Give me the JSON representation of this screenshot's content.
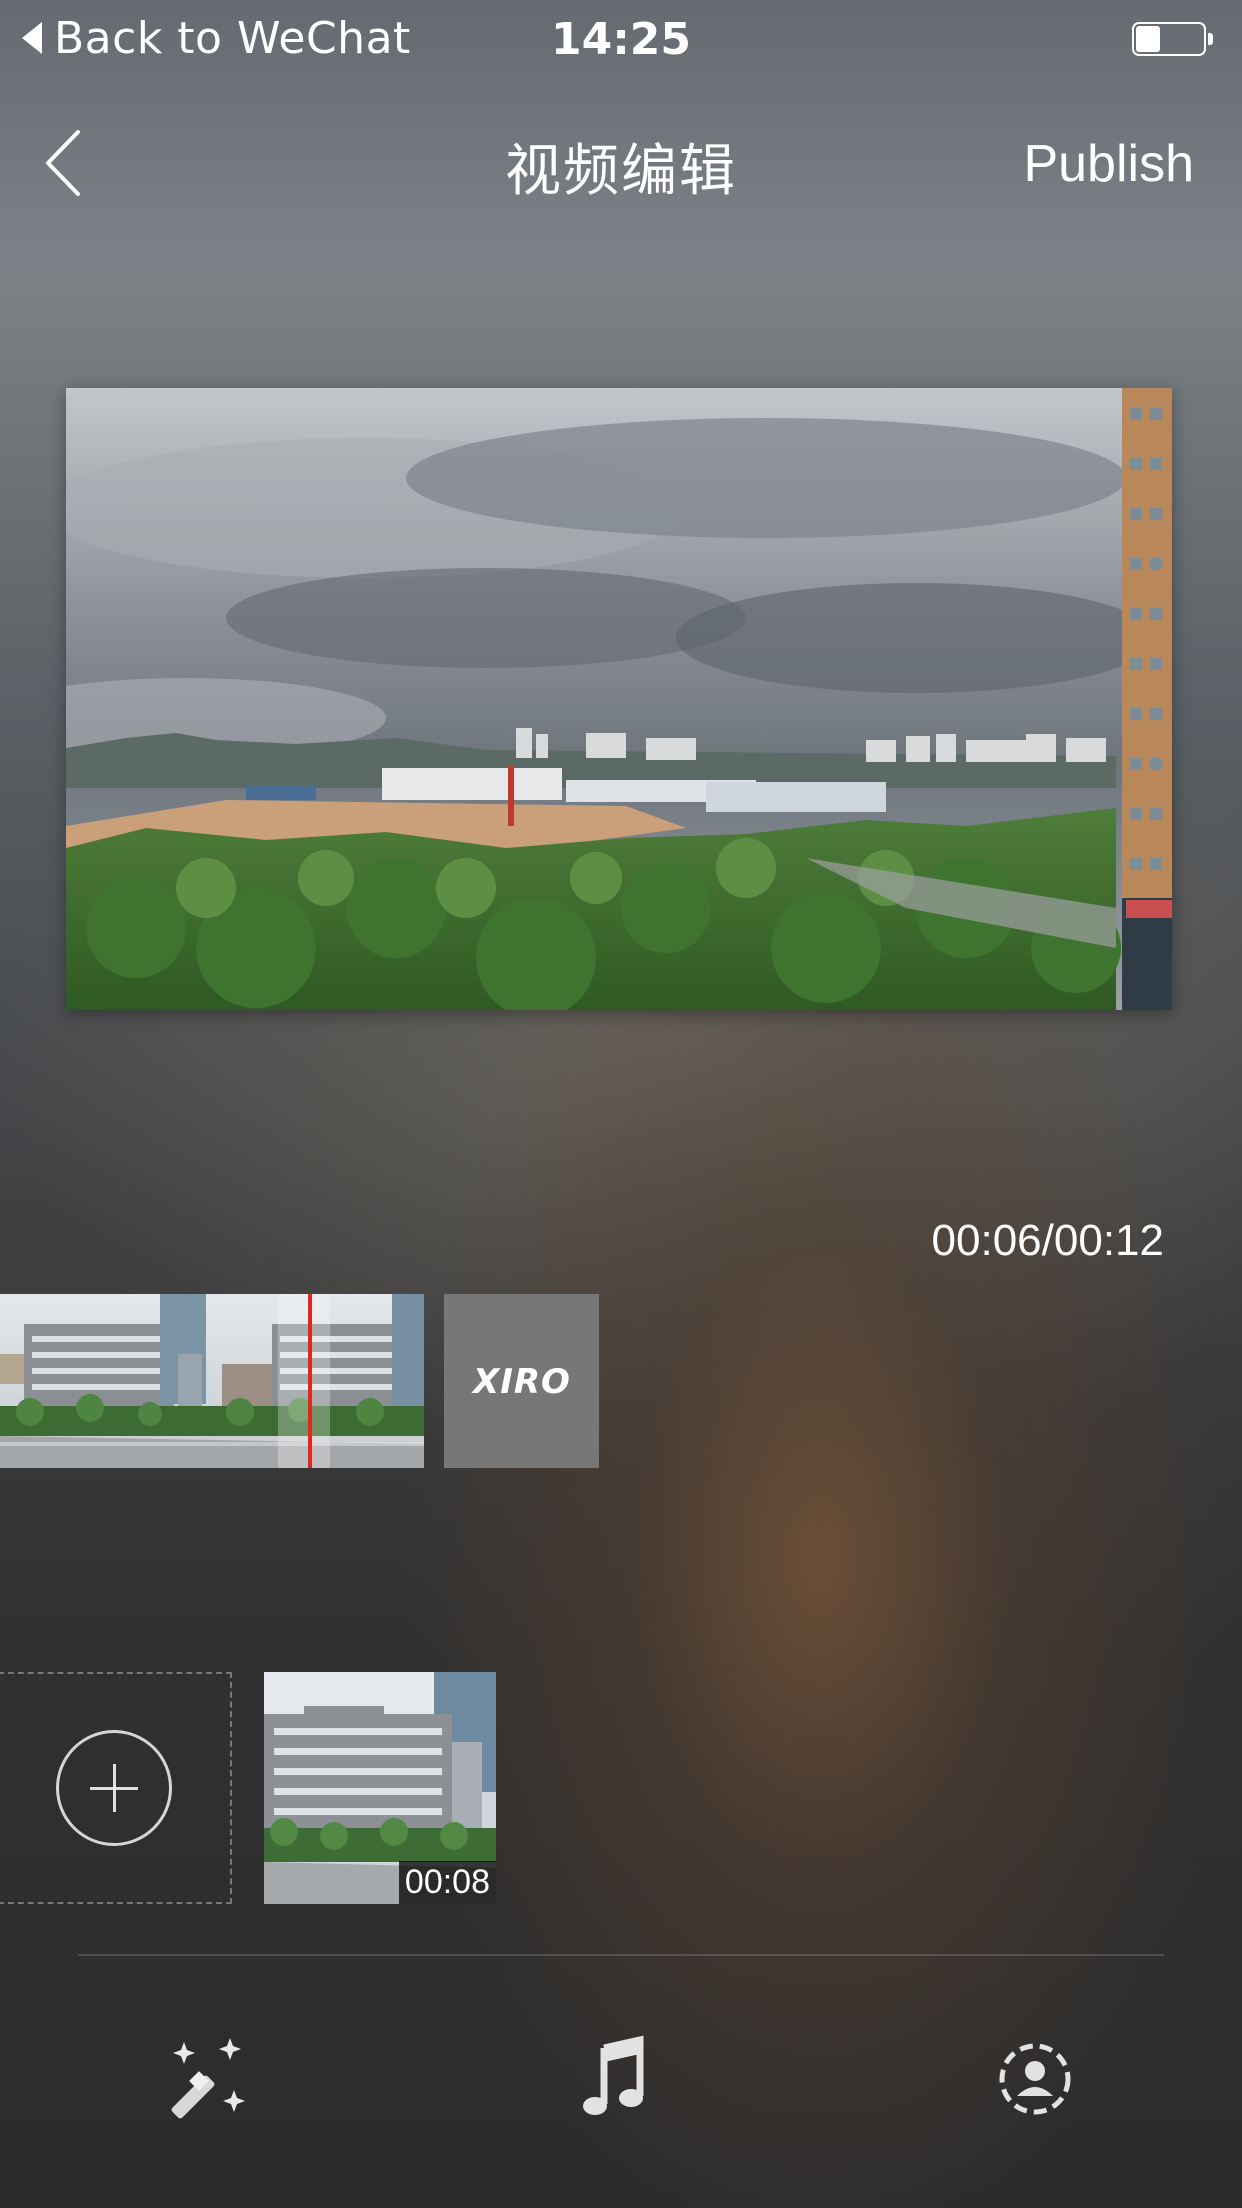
{
  "status_bar": {
    "back_label": "Back to WeChat",
    "time": "14:25"
  },
  "nav": {
    "title": "视频编辑",
    "publish_label": "Publish"
  },
  "player": {
    "timecode": "00:06/00:12"
  },
  "timeline": {
    "end_clip_logo": "XIRO"
  },
  "clips": [
    {
      "duration": "00:08"
    }
  ],
  "toolbar": {
    "items": [
      {
        "icon": "magic-wand-icon"
      },
      {
        "icon": "music-note-icon"
      },
      {
        "icon": "avatar-icon"
      }
    ]
  },
  "colors": {
    "playhead": "#e0261d",
    "text": "#ffffff"
  }
}
